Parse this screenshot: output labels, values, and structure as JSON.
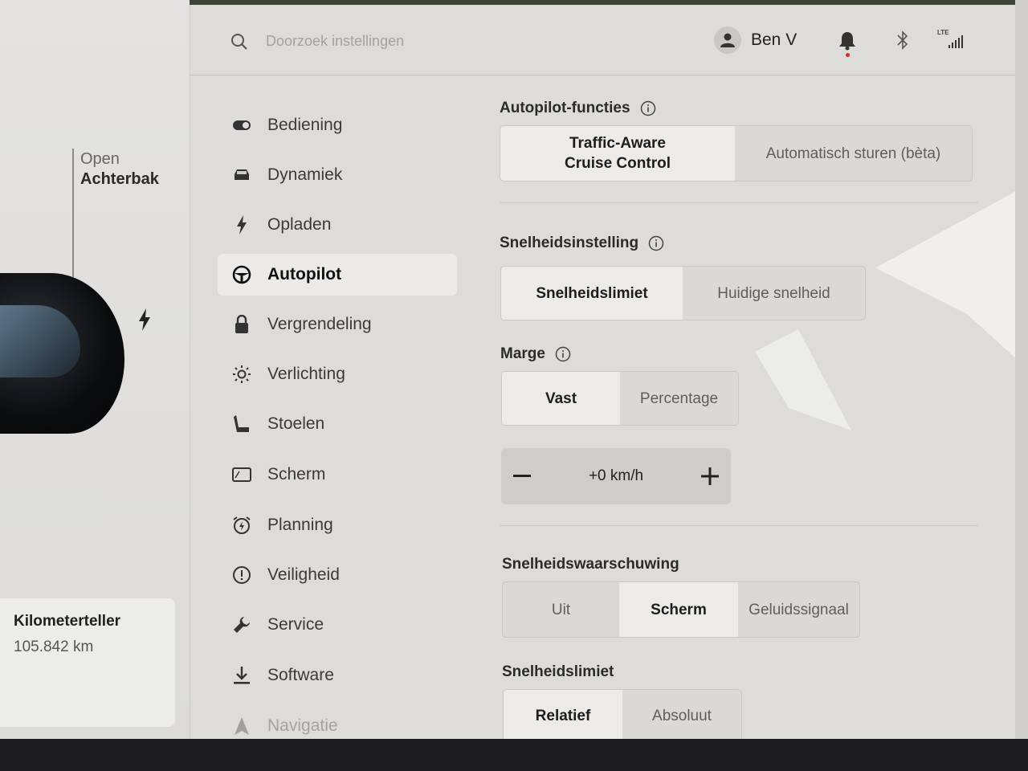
{
  "left_panel": {
    "trunk_line1": "Open",
    "trunk_line2": "Achterbak",
    "odometer": {
      "title": "Kilometerteller",
      "value": "105.842 km"
    }
  },
  "topbar": {
    "search_placeholder": "Doorzoek instellingen",
    "user_name": "Ben V",
    "network_label": "LTE"
  },
  "nav": {
    "items": [
      {
        "label": "Bediening",
        "icon": "toggle-icon"
      },
      {
        "label": "Dynamiek",
        "icon": "car-icon"
      },
      {
        "label": "Opladen",
        "icon": "bolt-icon"
      },
      {
        "label": "Autopilot",
        "icon": "steering-wheel-icon",
        "active": true
      },
      {
        "label": "Vergrendeling",
        "icon": "lock-icon"
      },
      {
        "label": "Verlichting",
        "icon": "light-icon"
      },
      {
        "label": "Stoelen",
        "icon": "seat-icon"
      },
      {
        "label": "Scherm",
        "icon": "display-icon"
      },
      {
        "label": "Planning",
        "icon": "alarm-clock-icon"
      },
      {
        "label": "Veiligheid",
        "icon": "alert-circle-icon"
      },
      {
        "label": "Service",
        "icon": "wrench-icon"
      },
      {
        "label": "Software",
        "icon": "download-icon"
      },
      {
        "label": "Navigatie",
        "icon": "navigation-icon"
      }
    ]
  },
  "content": {
    "autopilot_functions": {
      "title": "Autopilot-functies",
      "options": [
        "Traffic-Aware\nCruise Control",
        "Automatisch sturen (bèta)"
      ],
      "selected": 0
    },
    "speed_setting": {
      "title": "Snelheidsinstelling",
      "options": [
        "Snelheidslimiet",
        "Huidige snelheid"
      ],
      "selected": 0
    },
    "margin": {
      "title": "Marge",
      "options": [
        "Vast",
        "Percentage"
      ],
      "selected": 0,
      "stepper_value": "+0 km/h"
    },
    "speed_warning": {
      "title": "Snelheidswaarschuwing",
      "options": [
        "Uit",
        "Scherm",
        "Geluidssignaal"
      ],
      "selected": 1
    },
    "speed_limit": {
      "title": "Snelheidslimiet",
      "options": [
        "Relatief",
        "Absoluut"
      ],
      "selected": 0
    }
  },
  "colors": {
    "background": "#dddcd8",
    "selected_segment": "#ecebe8",
    "notification_dot": "#d62a2a"
  }
}
